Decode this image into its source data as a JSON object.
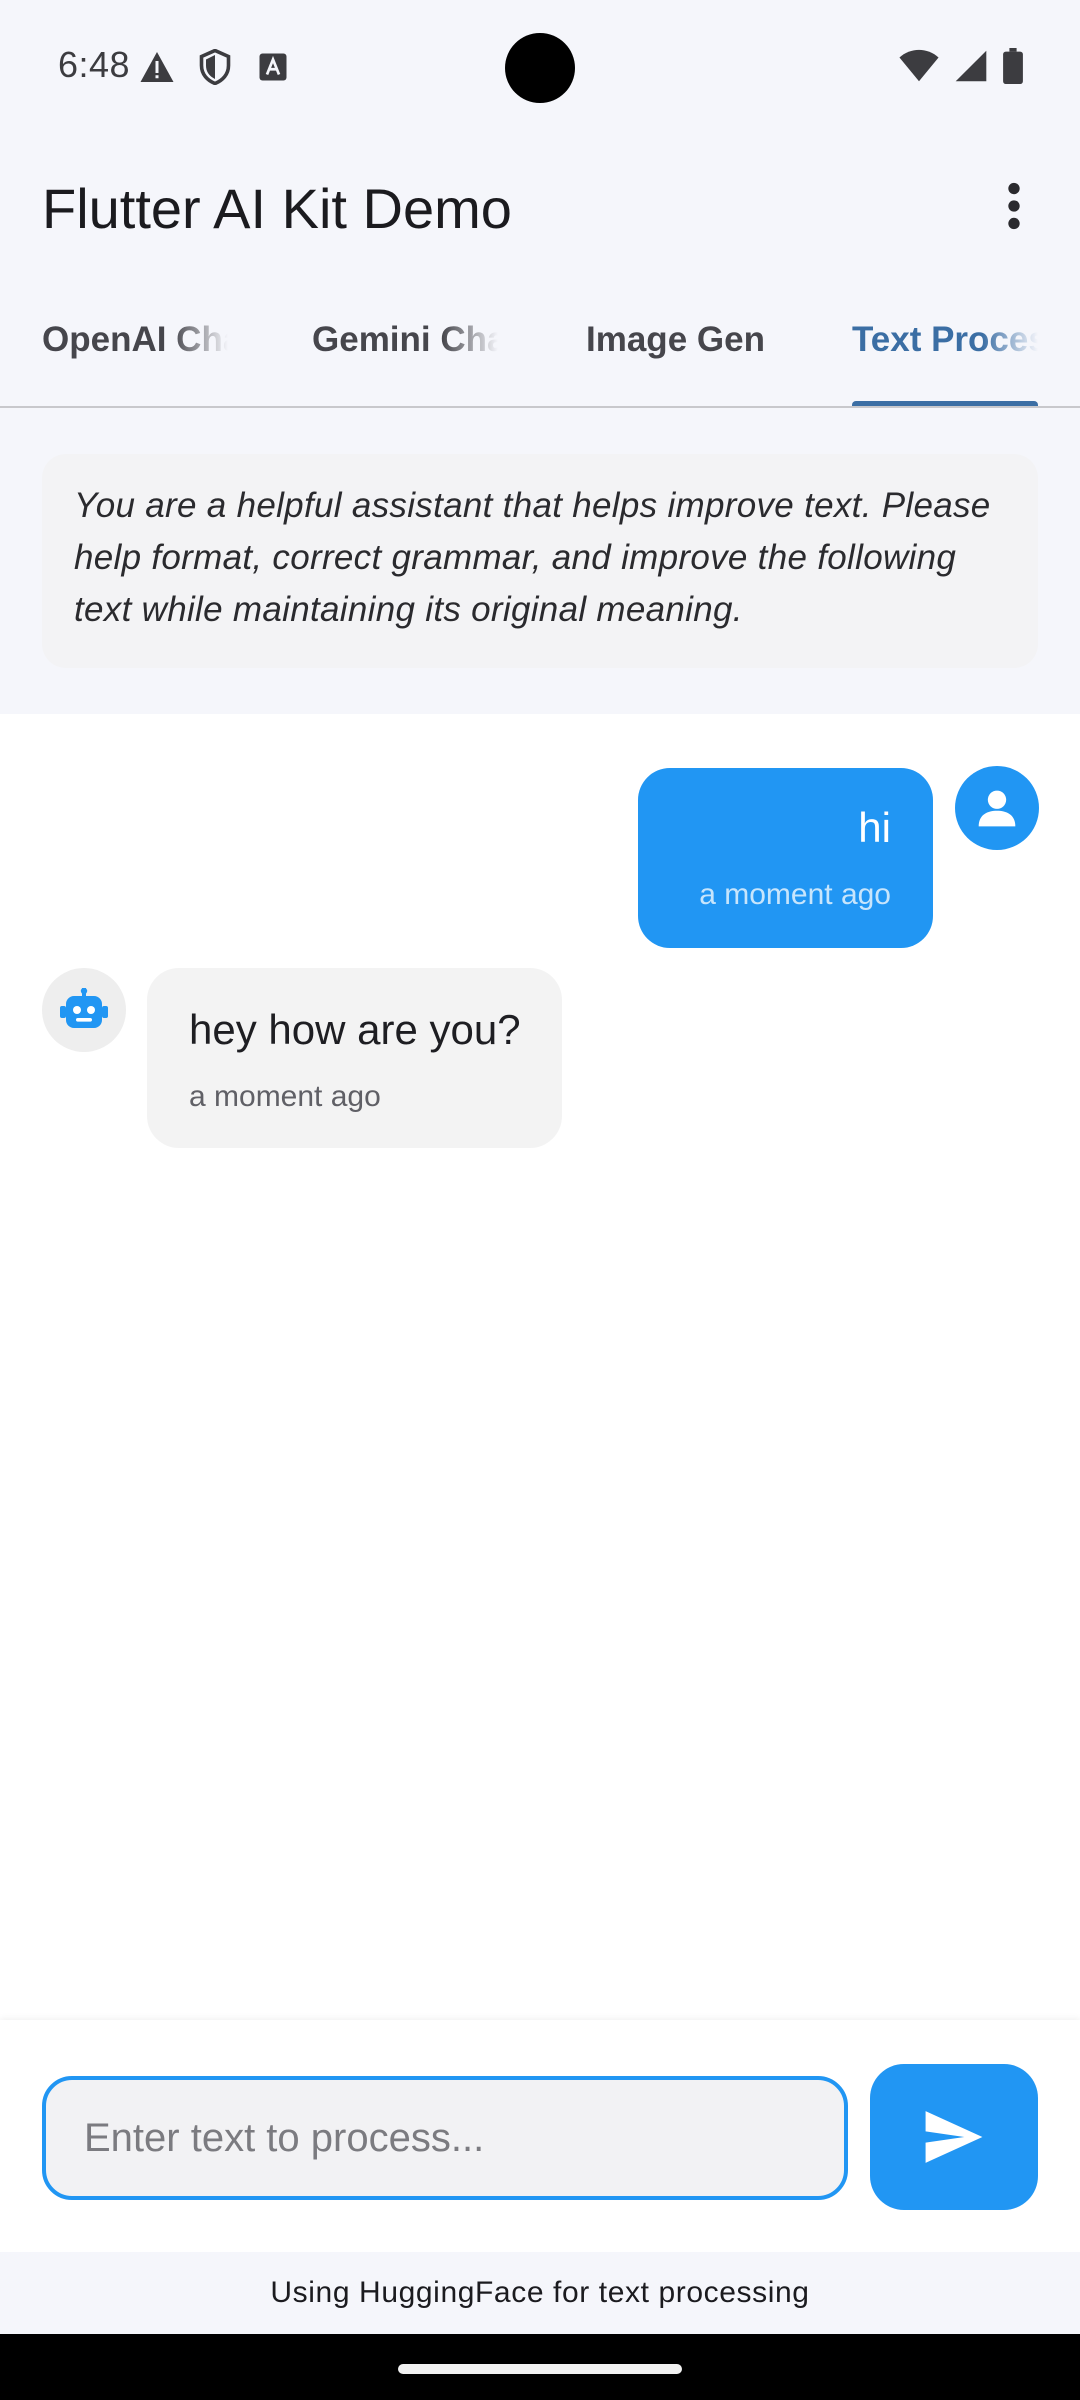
{
  "status_bar": {
    "time": "6:48",
    "left_icons": [
      "warning-icon",
      "shield-icon",
      "keyboard-a-icon"
    ],
    "right_icons": [
      "wifi-icon",
      "signal-icon",
      "battery-icon"
    ]
  },
  "app_bar": {
    "title": "Flutter AI Kit Demo",
    "menu_icon": "more-vert-icon"
  },
  "tabs": [
    {
      "label": "OpenAI Chat",
      "active": false
    },
    {
      "label": "Gemini Chat",
      "active": false
    },
    {
      "label": "Image Gen",
      "active": false
    },
    {
      "label": "Text Processing",
      "active": true
    }
  ],
  "system_prompt": "You are a helpful assistant that helps improve text. Please help format, correct grammar, and improve the following text while maintaining its original meaning.",
  "messages": [
    {
      "role": "user",
      "text": "hi",
      "time": "a moment ago"
    },
    {
      "role": "assistant",
      "text": "hey how are you?",
      "time": "a moment ago"
    }
  ],
  "input": {
    "placeholder": "Enter text to process...",
    "value": ""
  },
  "send_icon": "send-icon",
  "footer": "Using HuggingFace for text processing",
  "colors": {
    "accent": "#2196f3",
    "tab_active": "#3b6ea4",
    "background": "#f5f6fb",
    "bot_bubble": "#f3f3f3"
  }
}
